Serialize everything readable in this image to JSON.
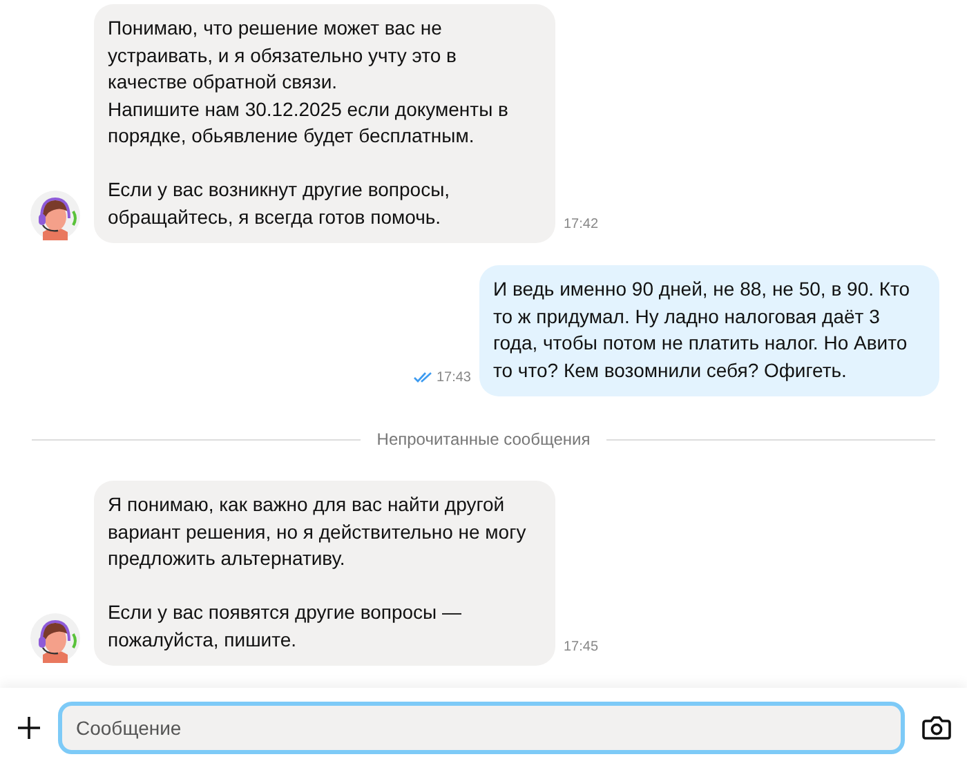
{
  "messages": [
    {
      "kind": "incoming",
      "text": "Понимаю, что решение может вас не устраивать, и я обязательно учту это в качестве обратной связи.\nНапишите нам 30.12.2025 если документы в порядке, обьявление будет бесплатным.\n\nЕсли у вас возникнут другие вопросы, обращайтесь, я всегда готов помочь.",
      "time": "17:42"
    },
    {
      "kind": "outgoing",
      "text": "И ведь именно 90 дней, не 88, не 50, в 90. Кто то ж придумал. Ну ладно налоговая даёт 3 года, чтобы потом не платить налог. Но Авито то что? Кем возомнили себя? Офигеть.",
      "time": "17:43",
      "read": true
    },
    {
      "kind": "divider",
      "text": "Непрочитанные сообщения"
    },
    {
      "kind": "incoming",
      "text": "Я понимаю, как важно для вас найти другой вариант решения, но я действительно не могу предложить альтернативу.\n\nЕсли у вас появятся другие вопросы — пожалуйста, пишите.",
      "time": "17:45"
    }
  ],
  "composer": {
    "placeholder": "Сообщение"
  }
}
